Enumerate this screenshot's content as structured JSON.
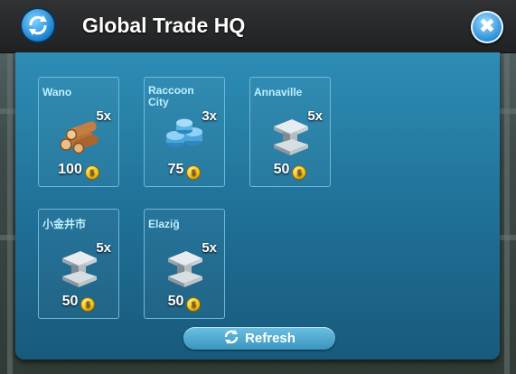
{
  "window": {
    "title": "Global Trade HQ"
  },
  "offers": [
    {
      "city": "Wano",
      "quantity": "5x",
      "price": "100",
      "resource_icon": "wood-logs-icon"
    },
    {
      "city": "Raccoon City",
      "quantity": "3x",
      "price": "75",
      "resource_icon": "metal-coins-icon"
    },
    {
      "city": "Annaville",
      "quantity": "5x",
      "price": "50",
      "resource_icon": "steel-beam-icon"
    },
    {
      "city": "小金井市",
      "quantity": "5x",
      "price": "50",
      "resource_icon": "steel-beam-icon"
    },
    {
      "city": "Elaziğ",
      "quantity": "5x",
      "price": "50",
      "resource_icon": "steel-beam-icon"
    }
  ],
  "refresh_label": "Refresh",
  "colors": {
    "panel": "#2578a1",
    "accent": "#3a95c0",
    "coin": "#f2c012"
  }
}
